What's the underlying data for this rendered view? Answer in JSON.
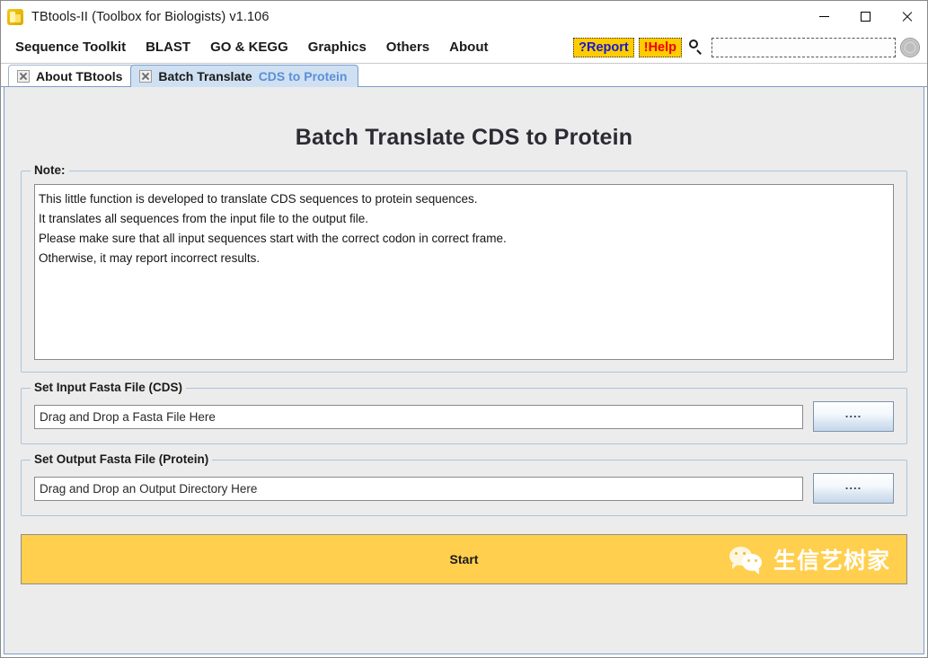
{
  "window": {
    "title": "TBtools-II (Toolbox for Biologists) v1.106",
    "app_icon": "tbtools-logo-icon",
    "controls": {
      "minimize": "minimize-icon",
      "maximize": "maximize-icon",
      "close": "close-icon"
    }
  },
  "menubar": {
    "items": [
      {
        "label": "Sequence Toolkit"
      },
      {
        "label": "BLAST"
      },
      {
        "label": "GO & KEGG"
      },
      {
        "label": "Graphics"
      },
      {
        "label": "Others"
      },
      {
        "label": "About"
      }
    ],
    "report_label": "?Report",
    "help_label": "!Help",
    "search_icon": "search-icon",
    "search_value": "",
    "search_placeholder": "",
    "knob_icon": "settings-knob-icon",
    "report_bg": "#ffcc00",
    "report_fg": "#1818d0",
    "help_fg": "#ee0000"
  },
  "tabs": [
    {
      "label": "About TBtools",
      "sub": "",
      "active": false,
      "close_icon": "tab-close-icon"
    },
    {
      "label": "Batch Translate",
      "sub": "CDS to Protein",
      "active": true,
      "close_icon": "tab-close-icon"
    }
  ],
  "main": {
    "page_title": "Batch Translate CDS to Protein",
    "note": {
      "title": "Note:",
      "lines": [
        "This little function is developed to translate CDS sequences to protein sequences.",
        "It translates all sequences from the input file to the output file.",
        "Please make sure that all input sequences start with the correct codon in correct frame.",
        "Otherwise, it may report incorrect results."
      ]
    },
    "input_file": {
      "title": "Set Input Fasta File (CDS)",
      "value": "",
      "placeholder": "Drag and Drop a Fasta File Here",
      "browse_label": "...."
    },
    "output_file": {
      "title": "Set Output Fasta File (Protein)",
      "value": "",
      "placeholder": "Drag and Drop an Output Directory Here",
      "browse_label": "...."
    },
    "start": {
      "label": "Start",
      "bg_color": "#ffcf4d",
      "watermark_icon": "wechat-icon",
      "watermark_text": "生信艺树家"
    }
  }
}
